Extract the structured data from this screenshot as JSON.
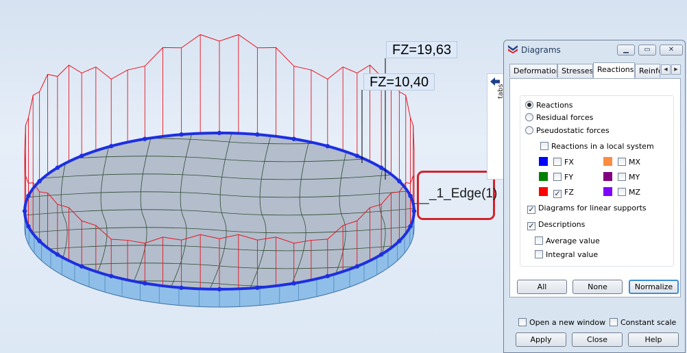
{
  "viewport": {
    "labels": {
      "fz_max": "FZ=19,63",
      "fz_min": "FZ=10,40",
      "edge": "_1_Edge(1)"
    },
    "colors": {
      "diagram": "#e8121c",
      "edge": "#1d2fe0",
      "slab": "#b3bdcc",
      "mesh": "#2f4a2f",
      "slab_side": "#8fbfe8"
    }
  },
  "side_tab": {
    "label": "tabs",
    "icon": "arrow-left-icon"
  },
  "dialog": {
    "title": "Diagrams",
    "window_buttons": {
      "minimize": "minimize-icon",
      "restore": "restore-icon",
      "close": "close-icon"
    },
    "tabs": [
      "Deformation",
      "Stresses",
      "Reactions",
      "Reinfc"
    ],
    "active_tab": "Reactions",
    "radios": [
      {
        "label": "Reactions",
        "selected": true
      },
      {
        "label": "Residual forces",
        "selected": false
      },
      {
        "label": "Pseudostatic forces",
        "selected": false
      }
    ],
    "local_system": {
      "label": "Reactions in a local system",
      "checked": false
    },
    "components": [
      {
        "label": "FX",
        "color": "#0000ff",
        "checked": false
      },
      {
        "label": "MX",
        "color": "#ff8c42",
        "checked": false
      },
      {
        "label": "FY",
        "color": "#008000",
        "checked": false
      },
      {
        "label": "MY",
        "color": "#800080",
        "checked": false
      },
      {
        "label": "FZ",
        "color": "#ff0000",
        "checked": true
      },
      {
        "label": "MZ",
        "color": "#8000ff",
        "checked": false
      }
    ],
    "linear_supports": {
      "label": "Diagrams for linear supports",
      "checked": true
    },
    "descriptions": {
      "label": "Descriptions",
      "checked": true
    },
    "average_value": {
      "label": "Average value",
      "checked": false
    },
    "integral_value": {
      "label": "Integral value",
      "checked": false
    },
    "buttons": {
      "all": "All",
      "none": "None",
      "normalize": "Normalize"
    },
    "open_new_window": {
      "label": "Open a new window",
      "checked": false
    },
    "constant_scale": {
      "label": "Constant scale",
      "checked": false
    },
    "footer_buttons": {
      "apply": "Apply",
      "close": "Close",
      "help": "Help"
    }
  }
}
